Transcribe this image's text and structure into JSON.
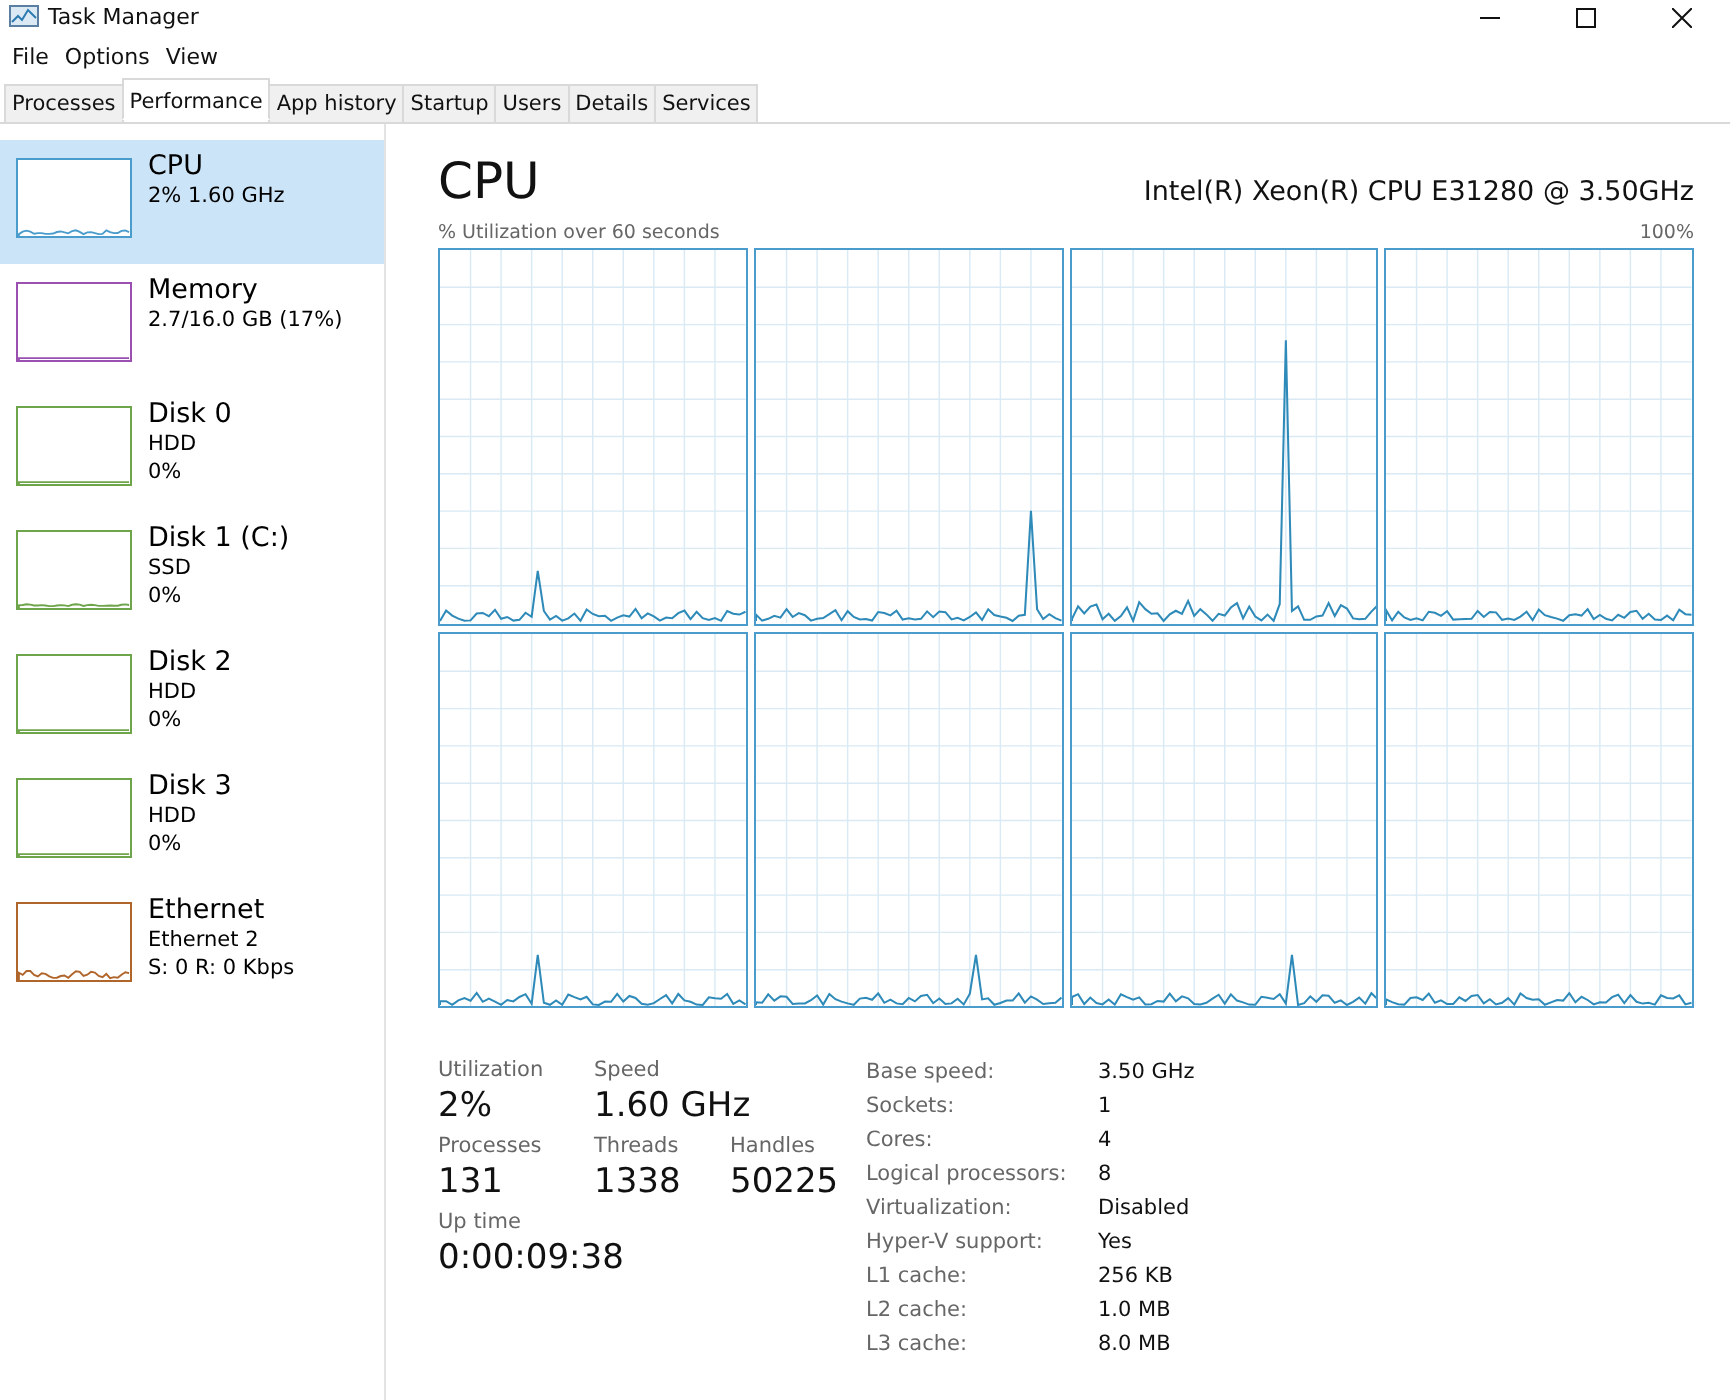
{
  "window": {
    "title": "Task Manager"
  },
  "menu": [
    "File",
    "Options",
    "View"
  ],
  "tabs": [
    {
      "label": "Processes",
      "selected": false
    },
    {
      "label": "Performance",
      "selected": true
    },
    {
      "label": "App history",
      "selected": false
    },
    {
      "label": "Startup",
      "selected": false
    },
    {
      "label": "Users",
      "selected": false
    },
    {
      "label": "Details",
      "selected": false
    },
    {
      "label": "Services",
      "selected": false
    }
  ],
  "sidebar": {
    "items": [
      {
        "name": "CPU",
        "lines": [
          "2% 1.60 GHz"
        ],
        "color": "#4a9ccc",
        "selected": true
      },
      {
        "name": "Memory",
        "lines": [
          "2.7/16.0 GB (17%)"
        ],
        "color": "#9b4fb0",
        "selected": false
      },
      {
        "name": "Disk 0",
        "lines": [
          "HDD",
          "0%"
        ],
        "color": "#6ea54a",
        "selected": false
      },
      {
        "name": "Disk 1 (C:)",
        "lines": [
          "SSD",
          "0%"
        ],
        "color": "#6ea54a",
        "selected": false
      },
      {
        "name": "Disk 2",
        "lines": [
          "HDD",
          "0%"
        ],
        "color": "#6ea54a",
        "selected": false
      },
      {
        "name": "Disk 3",
        "lines": [
          "HDD",
          "0%"
        ],
        "color": "#6ea54a",
        "selected": false
      },
      {
        "name": "Ethernet",
        "lines": [
          "Ethernet 2",
          "S: 0 R: 0 Kbps"
        ],
        "color": "#b0652a",
        "selected": false
      }
    ]
  },
  "main": {
    "title": "CPU",
    "model": "Intel(R) Xeon(R) CPU E31280 @ 3.50GHz",
    "graph_caption": "% Utilization over 60 seconds",
    "graph_max": "100%",
    "big_stats": [
      {
        "label": "Utilization",
        "value": "2%"
      },
      {
        "label": "Speed",
        "value": "1.60 GHz"
      },
      {
        "label": "Processes",
        "value": "131"
      },
      {
        "label": "Threads",
        "value": "1338"
      },
      {
        "label": "Handles",
        "value": "50225"
      },
      {
        "label": "Up time",
        "value": "0:00:09:38"
      }
    ],
    "details": [
      {
        "label": "Base speed:",
        "value": "3.50 GHz"
      },
      {
        "label": "Sockets:",
        "value": "1"
      },
      {
        "label": "Cores:",
        "value": "4"
      },
      {
        "label": "Logical processors:",
        "value": "8"
      },
      {
        "label": "Virtualization:",
        "value": "Disabled"
      },
      {
        "label": "Hyper-V support:",
        "value": "Yes"
      },
      {
        "label": "L1 cache:",
        "value": "256 KB"
      },
      {
        "label": "L2 cache:",
        "value": "1.0 MB"
      },
      {
        "label": "L3 cache:",
        "value": "8.0 MB"
      }
    ]
  }
}
